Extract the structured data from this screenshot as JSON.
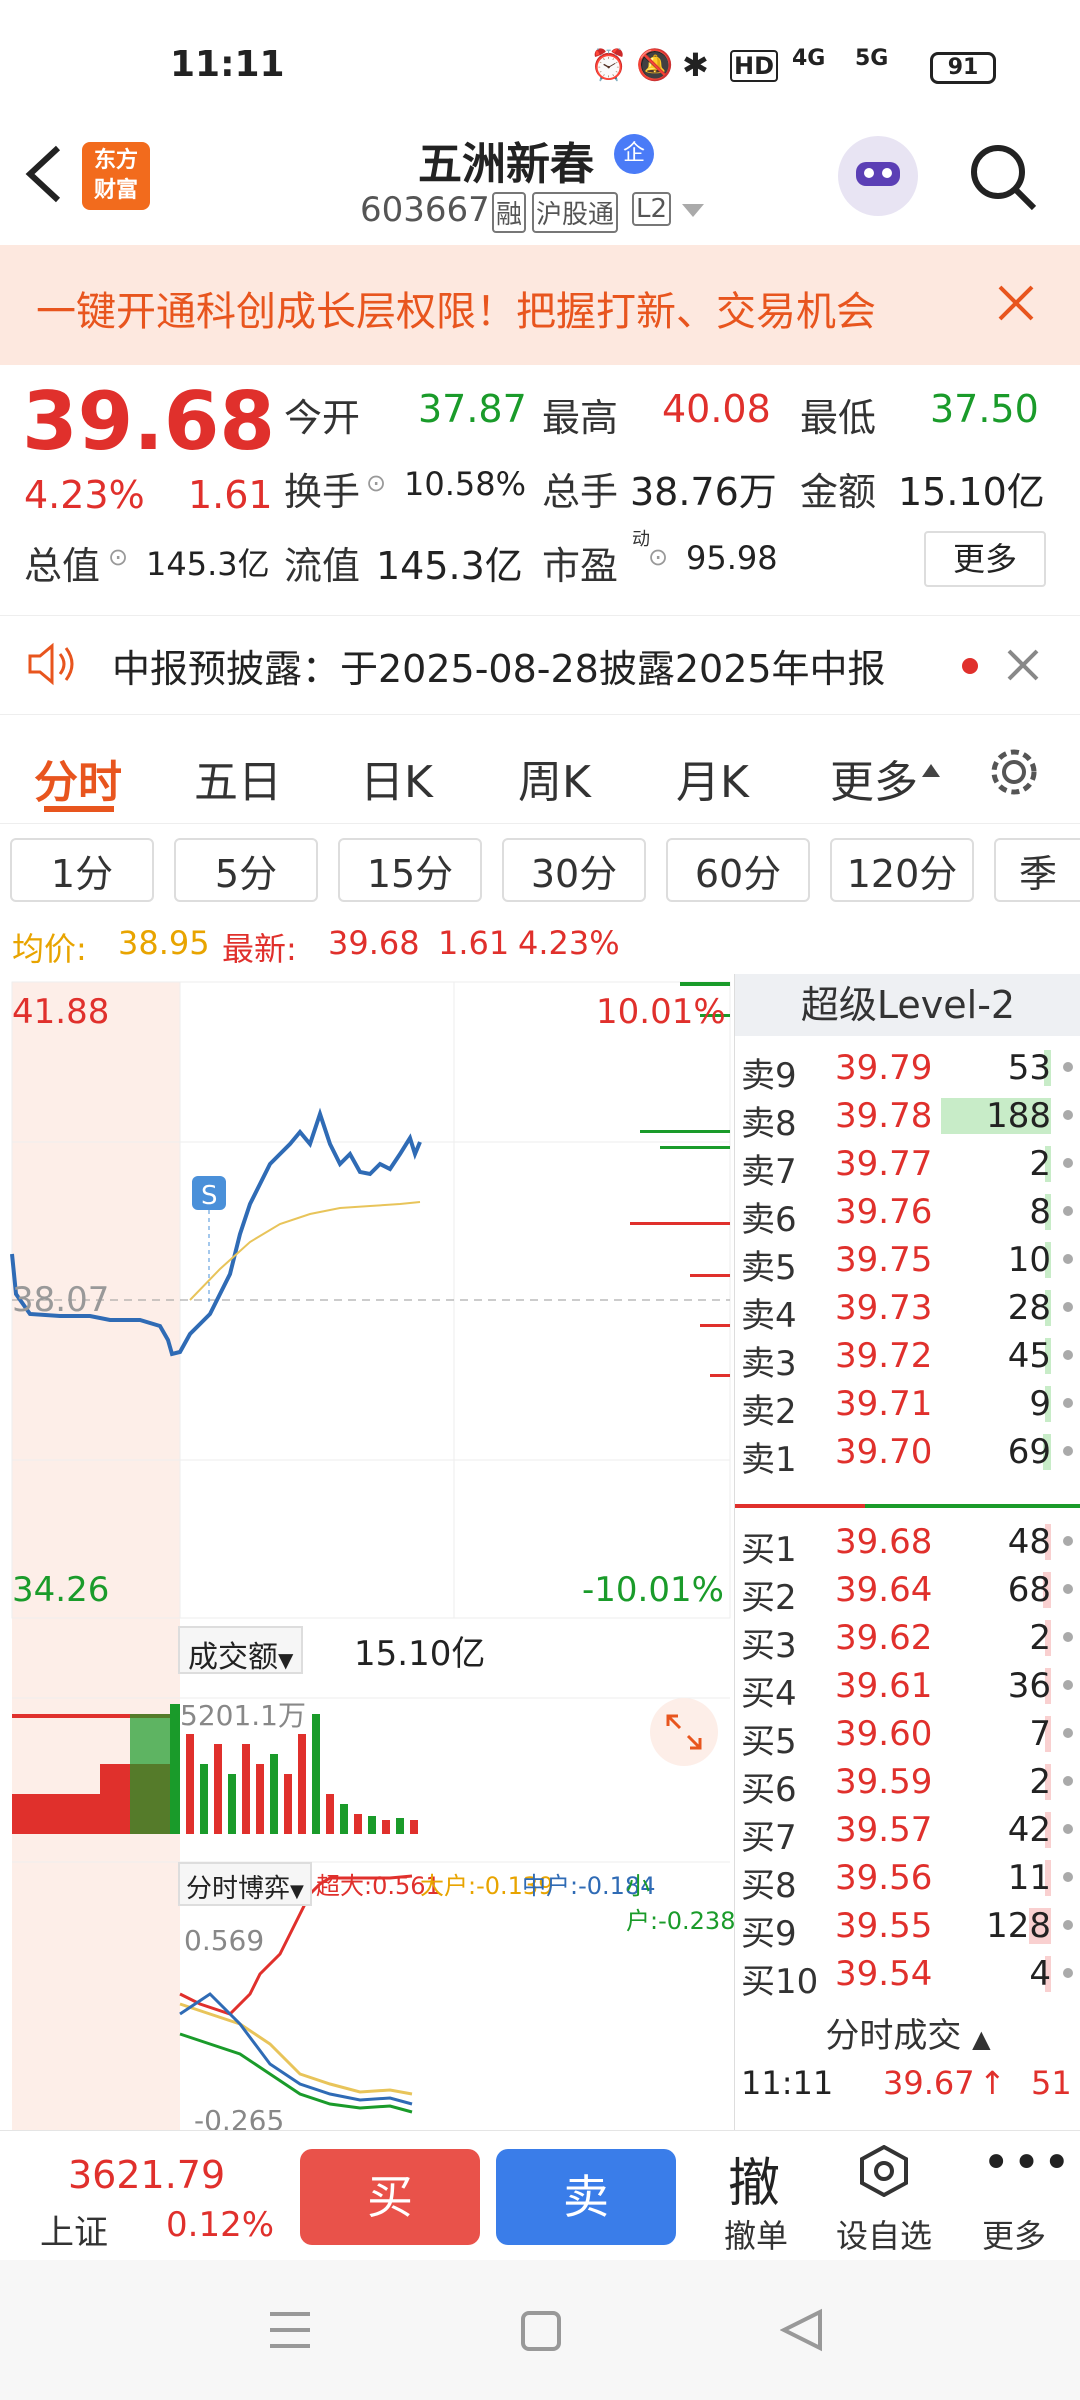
{
  "status": {
    "time": "11:11",
    "hd": "HD",
    "net1": "4G",
    "net2": "5G",
    "battery": "91"
  },
  "header": {
    "brand_line1": "东方",
    "brand_line2": "财富",
    "stock_name": "五洲新春",
    "badge": "企",
    "code": "603667",
    "tag_rong": "融",
    "tag_hgt": "沪股通",
    "tag_level": "L2"
  },
  "banner": {
    "text": "一键开通科创成长层权限！把握打新、交易机会"
  },
  "quote": {
    "price": "39.68",
    "change_pct": "4.23%",
    "change": "1.61",
    "open_label": "今开",
    "open": "37.87",
    "high_label": "最高",
    "high": "40.08",
    "low_label": "最低",
    "low": "37.50",
    "turnover_label": "换手",
    "turnover": "10.58%",
    "volume_label": "总手",
    "volume": "38.76万",
    "amount_label": "金额",
    "amount": "15.10亿",
    "mktcap_label": "总值",
    "mktcap": "145.3亿",
    "float_label": "流值",
    "float": "145.3亿",
    "pe_label": "市盈",
    "pe_sup": "动",
    "pe": "95.98",
    "more": "更多"
  },
  "notice": {
    "text": "中报预披露：于2025-08-28披露2025年中报"
  },
  "tabs": [
    "分时",
    "五日",
    "日K",
    "周K",
    "月K",
    "更多"
  ],
  "periods": [
    "1分",
    "5分",
    "15分",
    "30分",
    "60分",
    "120分",
    "季"
  ],
  "avgline": {
    "avg_label": "均价:",
    "avg": "38.95",
    "latest_label": "最新:",
    "latest": "39.68",
    "chg": "1.61",
    "pct": "4.23%"
  },
  "chart": {
    "top_price": "41.88",
    "bottom_price": "34.26",
    "top_pct": "10.01%",
    "bottom_pct": "-10.01%",
    "ref_price": "38.07",
    "s_marker": "S",
    "vol_label": "成交额",
    "vol_total": "15.10亿",
    "vol_max": "5201.1万",
    "game_label": "分时博弈",
    "super_label": "超大:",
    "super": "0.561",
    "big_label": "大户:",
    "big": "-0.139",
    "mid_label": "中户:",
    "mid": "-0.184",
    "small_label": "小户:",
    "small": "-0.238",
    "game_top": "0.569",
    "game_bottom": "-0.265"
  },
  "orderbook": {
    "title": "超级Level-2",
    "asks": [
      {
        "label": "卖9",
        "price": "39.79",
        "qty": "53",
        "bar": 0.06
      },
      {
        "label": "卖8",
        "price": "39.78",
        "qty": "188",
        "bar": 1.0
      },
      {
        "label": "卖7",
        "price": "39.77",
        "qty": "2",
        "bar": 0.02
      },
      {
        "label": "卖6",
        "price": "39.76",
        "qty": "8",
        "bar": 0.02
      },
      {
        "label": "卖5",
        "price": "39.75",
        "qty": "10",
        "bar": 0.02
      },
      {
        "label": "卖4",
        "price": "39.73",
        "qty": "28",
        "bar": 0.04
      },
      {
        "label": "卖3",
        "price": "39.72",
        "qty": "45",
        "bar": 0.05
      },
      {
        "label": "卖2",
        "price": "39.71",
        "qty": "9",
        "bar": 0.02
      },
      {
        "label": "卖1",
        "price": "39.70",
        "qty": "69",
        "bar": 0.07
      }
    ],
    "bids": [
      {
        "label": "买1",
        "price": "39.68",
        "qty": "48",
        "bar": 0.05
      },
      {
        "label": "买2",
        "price": "39.64",
        "qty": "68",
        "bar": 0.07
      },
      {
        "label": "买3",
        "price": "39.62",
        "qty": "2",
        "bar": 0.02
      },
      {
        "label": "买4",
        "price": "39.61",
        "qty": "36",
        "bar": 0.04
      },
      {
        "label": "买5",
        "price": "39.60",
        "qty": "7",
        "bar": 0.02
      },
      {
        "label": "买6",
        "price": "39.59",
        "qty": "2",
        "bar": 0.02
      },
      {
        "label": "买7",
        "price": "39.57",
        "qty": "42",
        "bar": 0.05
      },
      {
        "label": "买8",
        "price": "39.56",
        "qty": "11",
        "bar": 0.02
      },
      {
        "label": "买9",
        "price": "39.55",
        "qty": "128",
        "bar": 0.2
      },
      {
        "label": "买10",
        "price": "39.54",
        "qty": "4",
        "bar": 0.02
      }
    ],
    "trades_title": "分时成交",
    "trade": {
      "time": "11:11",
      "price": "39.67",
      "qty": "51"
    }
  },
  "bottom": {
    "index_value": "3621.79",
    "index_name": "上证",
    "index_pct": "0.12%",
    "buy": "买",
    "sell": "卖",
    "cancel_icon": "撤",
    "cancel": "撤单",
    "watch": "设自选",
    "more": "更多"
  }
}
